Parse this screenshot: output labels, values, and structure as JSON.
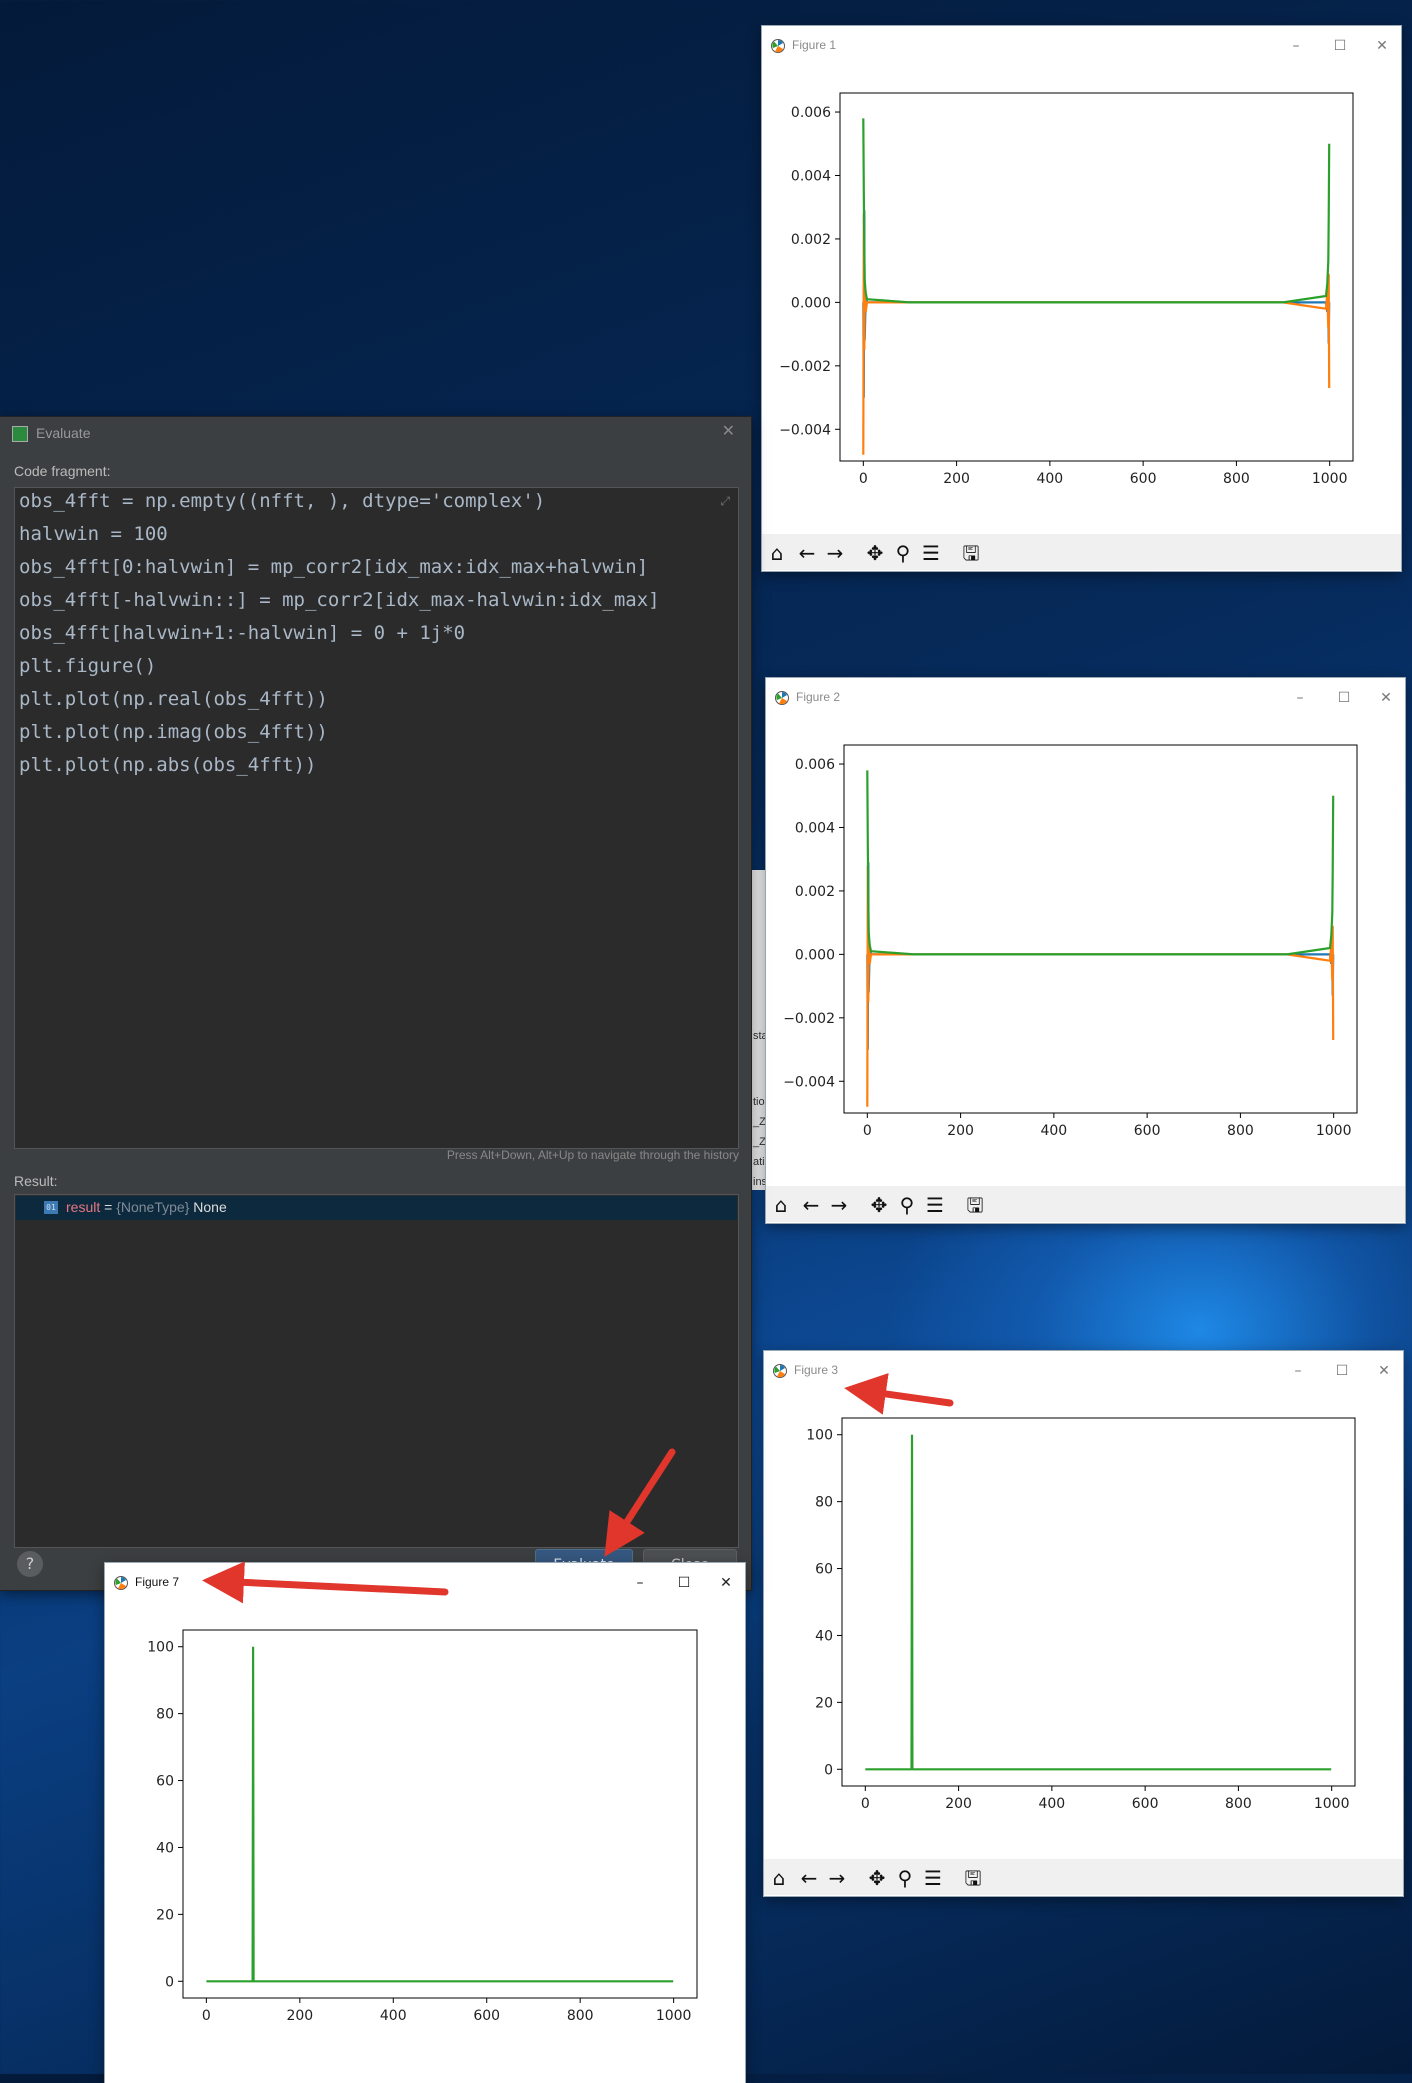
{
  "figures": {
    "figure1": {
      "title": "Figure 1",
      "active": false
    },
    "figure2": {
      "title": "Figure 2",
      "active": false
    },
    "figure3": {
      "title": "Figure 3",
      "active": false
    },
    "figure7": {
      "title": "Figure 7",
      "active": true
    }
  },
  "window_controls": {
    "minimize": "–",
    "maximize": "☐",
    "close": "✕"
  },
  "toolbar_icons": [
    "home-icon",
    "back-arrow-icon",
    "forward-arrow-icon",
    "pan-icon",
    "zoom-icon",
    "configure-subplots-icon",
    "save-icon"
  ],
  "evaluate": {
    "title": "Evaluate",
    "code_fragment_label": "Code fragment:",
    "code_lines": [
      "obs_4fft = np.empty((nfft, ), dtype='complex')",
      "halvwin = 100",
      "obs_4fft[0:halvwin] = mp_corr2[idx_max:idx_max+halvwin]",
      "obs_4fft[-halvwin::] = mp_corr2[idx_max-halvwin:idx_max]",
      "obs_4fft[halvwin+1:-halvwin] = 0 + 1j*0",
      "plt.figure()",
      "plt.plot(np.real(obs_4fft))",
      "plt.plot(np.imag(obs_4fft))",
      "plt.plot(np.abs(obs_4fft))"
    ],
    "history_hint": "Press Alt+Down, Alt+Up to navigate through the history",
    "result_label": "Result:",
    "result_badge": "01",
    "result_name": "result",
    "result_eq": " = ",
    "result_type": "{NoneType}",
    "result_value": " None",
    "help_label": "?",
    "evaluate_button": "Evaluate",
    "close_button": "Close"
  },
  "behind_window_text": [
    "sta",
    "tion",
    "_Z",
    "_Z",
    "ati",
    "ins"
  ],
  "chart_data": [
    {
      "id": "figure1",
      "type": "line",
      "xlim": [
        -50,
        1050
      ],
      "ylim": [
        -0.005,
        0.0066
      ],
      "xticks": [
        0,
        200,
        400,
        600,
        800,
        1000
      ],
      "yticks": [
        0.006,
        0.004,
        0.002,
        0.0,
        -0.002,
        -0.004
      ],
      "ytick_labels": [
        "0.006",
        "0.004",
        "0.002",
        "0.000",
        "−0.002",
        "−0.004"
      ],
      "series": [
        {
          "color": "#1f77b4",
          "x": [
            0,
            1,
            2,
            3,
            5,
            8,
            100,
            900,
            992,
            995,
            997,
            998,
            999
          ],
          "y": [
            0.0,
            -0.003,
            0.0029,
            -0.0012,
            0.0002,
            0.0,
            0.0,
            0.0,
            0.0,
            -0.0003,
            0.0,
            -0.0013,
            0.0
          ]
        },
        {
          "color": "#ff7f0e",
          "x": [
            0,
            1,
            2,
            3,
            5,
            8,
            100,
            900,
            992,
            995,
            997,
            998,
            999
          ],
          "y": [
            -0.0048,
            0.0028,
            -0.0015,
            0.0006,
            -0.0003,
            0.0,
            0.0,
            0.0,
            -0.0002,
            0.0003,
            -0.0008,
            0.0009,
            -0.0027
          ]
        },
        {
          "color": "#2ca02c",
          "x": [
            0,
            1,
            2,
            3,
            5,
            8,
            100,
            900,
            992,
            995,
            997,
            998,
            999
          ],
          "y": [
            0.0058,
            0.0035,
            0.0016,
            0.0007,
            0.0003,
            0.0001,
            0.0,
            0.0,
            0.0002,
            0.0006,
            0.0013,
            0.0026,
            0.005
          ]
        }
      ]
    },
    {
      "id": "figure2",
      "type": "line",
      "xlim": [
        -50,
        1050
      ],
      "ylim": [
        -0.005,
        0.0066
      ],
      "xticks": [
        0,
        200,
        400,
        600,
        800,
        1000
      ],
      "yticks": [
        0.006,
        0.004,
        0.002,
        0.0,
        -0.002,
        -0.004
      ],
      "ytick_labels": [
        "0.006",
        "0.004",
        "0.002",
        "0.000",
        "−0.002",
        "−0.004"
      ],
      "series": [
        {
          "color": "#1f77b4",
          "x": [
            0,
            1,
            2,
            3,
            5,
            8,
            100,
            900,
            992,
            995,
            997,
            998,
            999
          ],
          "y": [
            0.0,
            -0.003,
            0.0029,
            -0.0012,
            0.0002,
            0.0,
            0.0,
            0.0,
            0.0,
            -0.0003,
            0.0,
            -0.0013,
            0.0
          ]
        },
        {
          "color": "#ff7f0e",
          "x": [
            0,
            1,
            2,
            3,
            5,
            8,
            100,
            900,
            992,
            995,
            997,
            998,
            999
          ],
          "y": [
            -0.0048,
            0.0028,
            -0.0015,
            0.0006,
            -0.0003,
            0.0,
            0.0,
            0.0,
            -0.0002,
            0.0003,
            -0.0008,
            0.0009,
            -0.0027
          ]
        },
        {
          "color": "#2ca02c",
          "x": [
            0,
            1,
            2,
            3,
            5,
            8,
            100,
            900,
            992,
            995,
            997,
            998,
            999
          ],
          "y": [
            0.0058,
            0.0035,
            0.0016,
            0.0007,
            0.0003,
            0.0001,
            0.0,
            0.0,
            0.0002,
            0.0006,
            0.0013,
            0.0026,
            0.005
          ]
        }
      ]
    },
    {
      "id": "figure3",
      "type": "line",
      "xlim": [
        -50,
        1050
      ],
      "ylim": [
        -5,
        105
      ],
      "xticks": [
        0,
        200,
        400,
        600,
        800,
        1000
      ],
      "yticks": [
        100,
        80,
        60,
        40,
        20,
        0
      ],
      "ytick_labels": [
        "100",
        "80",
        "60",
        "40",
        "20",
        "0"
      ],
      "series": [
        {
          "color": "#2ca02c",
          "x": [
            0,
            99,
            100,
            101,
            999
          ],
          "y": [
            0,
            0,
            100,
            0,
            0
          ]
        }
      ]
    },
    {
      "id": "figure7",
      "type": "line",
      "xlim": [
        -50,
        1050
      ],
      "ylim": [
        -5,
        105
      ],
      "xticks": [
        0,
        200,
        400,
        600,
        800,
        1000
      ],
      "yticks": [
        100,
        80,
        60,
        40,
        20,
        0
      ],
      "ytick_labels": [
        "100",
        "80",
        "60",
        "40",
        "20",
        "0"
      ],
      "series": [
        {
          "color": "#2ca02c",
          "x": [
            0,
            99,
            100,
            101,
            999
          ],
          "y": [
            0,
            0,
            100,
            0,
            0
          ]
        }
      ]
    }
  ]
}
